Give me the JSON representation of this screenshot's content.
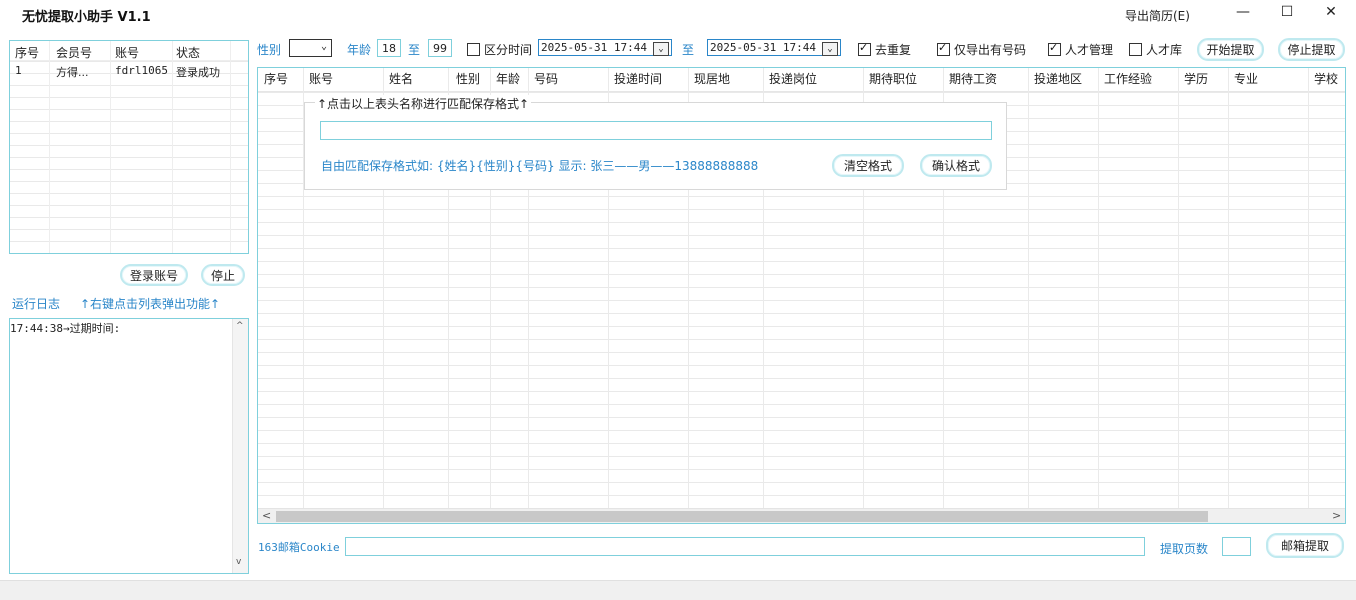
{
  "app": {
    "title": "无忧提取小助手 V1.1",
    "menu_export": "导出简历(E)",
    "window_minimize": "—",
    "window_maximize": "☐",
    "window_close": "✕"
  },
  "accounts": {
    "headers": [
      "序号",
      "会员号",
      "账号",
      "状态"
    ],
    "rows": [
      {
        "index": "1",
        "member": "方得...",
        "account": "fdrl1065",
        "status": "登录成功"
      }
    ],
    "login_button": "登录账号",
    "stop_button": "停止"
  },
  "log": {
    "label": "运行日志",
    "hint": "↑右键点击列表弹出功能↑",
    "lines": [
      "17:44:38→过期时间:"
    ]
  },
  "filters": {
    "gender_label": "性别",
    "gender_value": "",
    "age_label": "年龄",
    "age_from": "18",
    "age_to_label": "至",
    "age_to": "99",
    "distinguish_time_label": "区分时间",
    "distinguish_time_checked": false,
    "date_from": "2025-05-31 17:44",
    "date_to_label": "至",
    "date_to": "2025-05-31 17:44",
    "dedupe_label": "去重复",
    "dedupe_checked": true,
    "only_phone_label": "仅导出有号码",
    "only_phone_checked": true,
    "talent_manage_label": "人才管理",
    "talent_manage_checked": true,
    "talent_pool_label": "人才库",
    "talent_pool_checked": false,
    "start_button": "开始提取",
    "stop_button": "停止提取"
  },
  "results": {
    "headers": [
      "序号",
      "账号",
      "姓名",
      "性别",
      "年龄",
      "号码",
      "投递时间",
      "现居地",
      "投递岗位",
      "期待职位",
      "期待工资",
      "投递地区",
      "工作经验",
      "学历",
      "专业",
      "学校"
    ]
  },
  "format_panel": {
    "legend": "↑点击以上表头名称进行匹配保存格式↑",
    "input_value": "",
    "example": "自由匹配保存格式如: {姓名}{性别}{号码} 显示: 张三——男——13888888888",
    "clear_button": "清空格式",
    "confirm_button": "确认格式"
  },
  "bottom": {
    "cookie_label": "163邮箱Cookie",
    "cookie_value": "",
    "pages_label": "提取页数",
    "pages_value": "",
    "mail_button": "邮箱提取"
  },
  "scroll": {
    "left_arrow": "<",
    "right_arrow": ">",
    "up_arrow": "^",
    "down_arrow": "v"
  },
  "colors": {
    "accent": "#2a86c9",
    "border": "#7fd0dc"
  }
}
